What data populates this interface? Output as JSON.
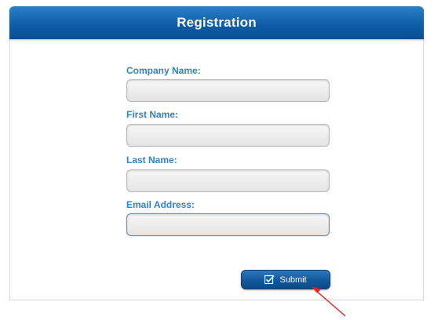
{
  "header": {
    "title": "Registration"
  },
  "form": {
    "fields": [
      {
        "label": "Company Name:",
        "value": "",
        "placeholder": ""
      },
      {
        "label": "First Name:",
        "value": "",
        "placeholder": ""
      },
      {
        "label": "Last Name:",
        "value": "",
        "placeholder": ""
      },
      {
        "label": "Email Address:",
        "value": "",
        "placeholder": ""
      }
    ],
    "submit_label": "Submit",
    "submit_icon": "checkbox-check-icon"
  },
  "annotation": {
    "arrow_color": "#e8231c"
  },
  "colors": {
    "header_blue": "#0f5ea8",
    "label_blue": "#2f83c9",
    "button_blue": "#135a9e"
  }
}
